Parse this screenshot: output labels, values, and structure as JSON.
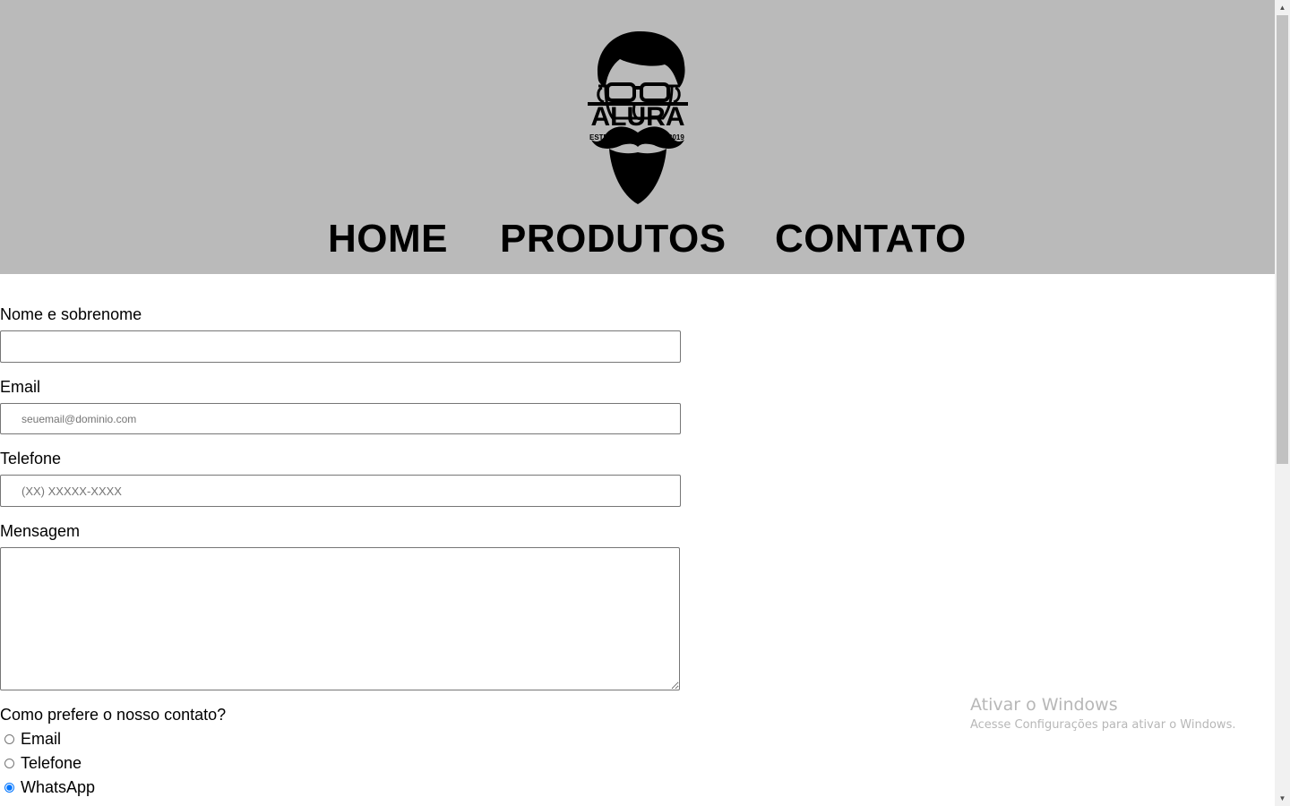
{
  "header": {
    "logo": {
      "icon": "bearded-man-glasses-logo-icon",
      "brand": "ALURA",
      "estd_label": "ESTD",
      "year": "2019"
    },
    "nav": {
      "home": "HOME",
      "produtos": "PRODUTOS",
      "contato": "CONTATO"
    }
  },
  "form": {
    "name_label": "Nome e sobrenome",
    "name_value": "",
    "email_label": "Email",
    "email_placeholder": "seuemail@dominio.com",
    "phone_label": "Telefone",
    "phone_placeholder": "(XX) XXXXX-XXXX",
    "message_label": "Mensagem",
    "contact_question": "Como prefere o nosso contato?",
    "contact_options": [
      {
        "label": "Email",
        "checked": false
      },
      {
        "label": "Telefone",
        "checked": false
      },
      {
        "label": "WhatsApp",
        "checked": true
      }
    ]
  },
  "watermark": {
    "title": "Ativar o Windows",
    "subtitle": "Acesse Configurações para ativar o Windows."
  },
  "colors": {
    "header_bg": "#bababa",
    "radio_accent": "#0075ff"
  }
}
